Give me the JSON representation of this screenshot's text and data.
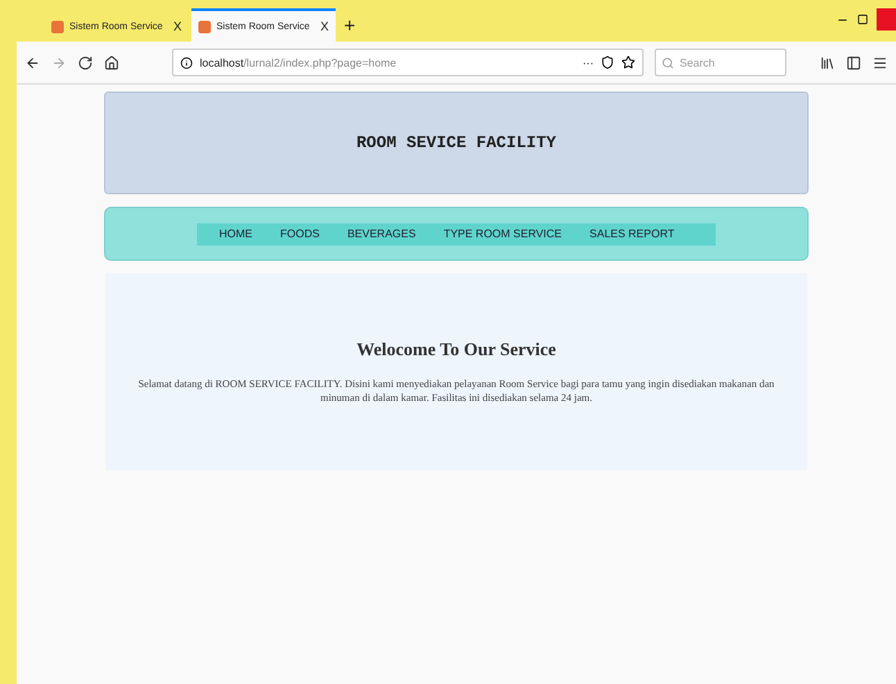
{
  "browser": {
    "tabs": [
      {
        "title": "Sistem Room Service",
        "selected": false,
        "close": "X"
      },
      {
        "title": "Sistem Room Service",
        "selected": true,
        "close": "X"
      }
    ],
    "new_tab": "+",
    "address": {
      "host": "localhost",
      "path": "/lurnal2/index.php?page=home"
    },
    "more": "···",
    "search": {
      "placeholder": "Search"
    }
  },
  "header": {
    "title": "ROOM SEVICE FACILITY"
  },
  "menu": [
    {
      "label": "HOME"
    },
    {
      "label": "FOODS"
    },
    {
      "label": "BEVERAGES"
    },
    {
      "label": "TYPE ROOM SERVICE"
    },
    {
      "label": "SALES REPORT"
    }
  ],
  "content": {
    "heading": "Welocome To Our Service",
    "text": "Selamat datang di ROOM SERVICE FACILITY. Disini kami menyediakan pelayanan Room Service bagi para tamu yang ingin disediakan makanan dan minuman di dalam kamar. Fasilitas ini disediakan selama 24 jam."
  }
}
